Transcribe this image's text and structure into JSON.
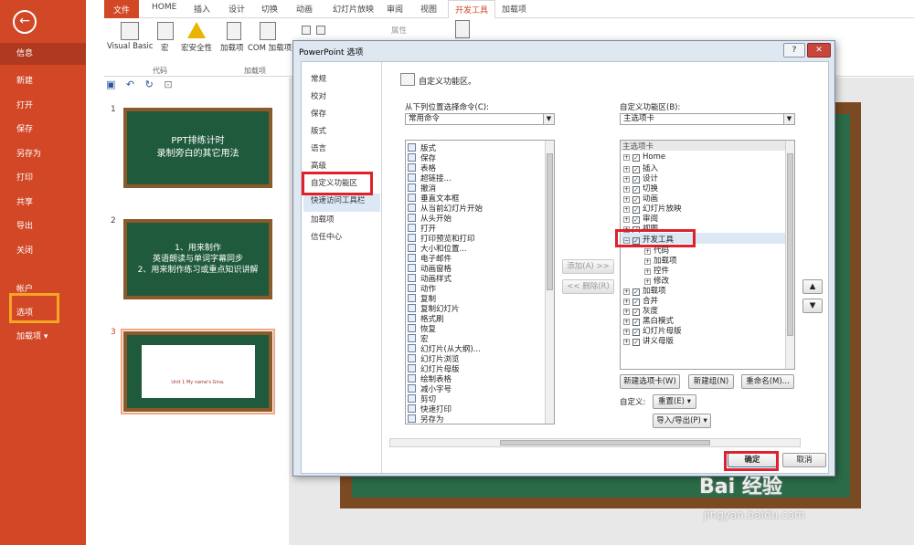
{
  "backstage": {
    "back_icon": "←",
    "items": [
      {
        "label": "信息",
        "selected": true
      },
      {
        "label": "新建"
      },
      {
        "label": "打开"
      },
      {
        "label": "保存"
      },
      {
        "label": "另存为"
      },
      {
        "label": "打印"
      },
      {
        "label": "共享"
      },
      {
        "label": "导出"
      },
      {
        "label": "关闭"
      },
      {
        "label": "帐户"
      },
      {
        "label": "选项"
      },
      {
        "label": "加载项 ▾"
      }
    ]
  },
  "ribbon": {
    "tabs": [
      "文件",
      "HOME",
      "插入",
      "设计",
      "切换",
      "动画",
      "幻灯片放映",
      "审阅",
      "视图",
      "开发工具",
      "加载项"
    ],
    "buttons": [
      "Visual Basic",
      "宏",
      "宏安全性",
      "加载项",
      "COM 加载项"
    ],
    "groups": [
      "代码",
      "加载项"
    ],
    "props_label": "属性"
  },
  "slides": [
    {
      "num": "1",
      "lines": [
        "PPT排练计时",
        "录制旁白的其它用法"
      ]
    },
    {
      "num": "2",
      "lines": [
        "1、用来制作",
        "英语朗读与单词字幕同步",
        "2、用来制作练习或重点知识讲解"
      ]
    },
    {
      "num": "3",
      "lines": [
        "Unit 1  My name's Gina."
      ]
    }
  ],
  "dialog": {
    "title": "PowerPoint 选项",
    "help": "?",
    "close": "✕",
    "nav": [
      "常规",
      "校对",
      "保存",
      "版式",
      "语言",
      "高级",
      "自定义功能区",
      "快速访问工具栏",
      "加载项",
      "信任中心"
    ],
    "header": "自定义功能区。",
    "left_label": "从下列位置选择命令(C):",
    "left_combo": "常用命令",
    "commands": [
      "版式",
      "保存",
      "表格",
      "超链接...",
      "撤消",
      "垂直文本框",
      "从当前幻灯片开始",
      "从头开始",
      "打开",
      "打印预览和打印",
      "大小和位置...",
      "电子邮件",
      "动画窗格",
      "动画样式",
      "动作",
      "复制",
      "复制幻灯片",
      "格式刷",
      "恢复",
      "宏",
      "幻灯片(从大纲)...",
      "幻灯片浏览",
      "幻灯片母版",
      "绘制表格",
      "减小字号",
      "剪切",
      "快速打印",
      "另存为"
    ],
    "add_btn": "添加(A) >>",
    "remove_btn": "<< 删除(R)",
    "right_label": "自定义功能区(B):",
    "right_combo": "主选项卡",
    "tree_header": "主选项卡",
    "tree": [
      "Home",
      "插入",
      "设计",
      "切换",
      "动画",
      "幻灯片放映",
      "审阅",
      "视图",
      "开发工具"
    ],
    "tree_children": [
      "代码",
      "加载项",
      "控件",
      "修改"
    ],
    "tree_after": [
      "加载项",
      "合并",
      "灰度",
      "黑白模式",
      "幻灯片母版",
      "讲义母版"
    ],
    "new_tab_btn": "新建选项卡(W)",
    "new_group_btn": "新建组(N)",
    "rename_btn": "重命名(M)...",
    "customize_label": "自定义:",
    "reset_btn": "重置(E) ▾",
    "import_btn": "导入/导出(P) ▾",
    "ok_btn": "确定",
    "cancel_btn": "取消"
  },
  "watermark": {
    "text": "Bai 经验",
    "url": "jingyan.baidu.com"
  },
  "colors": {
    "accent": "#d24726",
    "highlight_red": "#e0202a",
    "highlight_orange": "#f5a623"
  }
}
